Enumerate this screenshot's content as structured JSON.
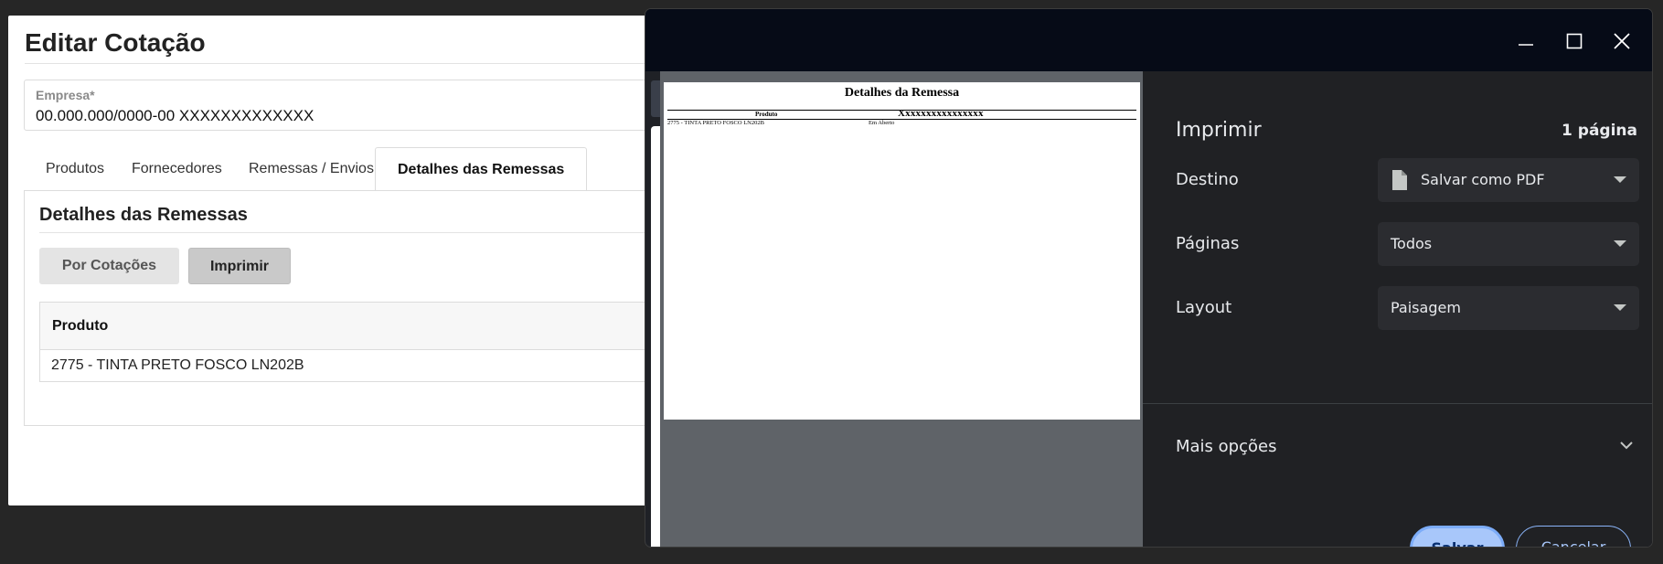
{
  "app": {
    "title": "Editar Cotação",
    "company": {
      "label": "Empresa*",
      "value": "00.000.000/0000-00 XXXXXXXXXXXXX"
    },
    "tabs": [
      {
        "label": "Produtos",
        "active": false
      },
      {
        "label": "Fornecedores",
        "active": false
      },
      {
        "label": "Remessas / Envios",
        "active": false
      },
      {
        "label": "Detalhes das Remessas",
        "active": true
      }
    ],
    "section": {
      "title": "Detalhes das Remessas",
      "buttons": {
        "por_cotacoes": "Por Cotações",
        "imprimir": "Imprimir"
      },
      "table": {
        "header": "Produto",
        "rows": [
          "2775 - TINTA PRETO FOSCO LN202B"
        ]
      }
    }
  },
  "print_dialog": {
    "preview": {
      "title": "Detalhes da Remessa",
      "column": "Produto",
      "masked": "Xxxxxxxxxxxxxxxx",
      "row": "2775 - TINTA PRETO FOSCO LN202B",
      "status": "Em Aberto"
    },
    "settings": {
      "title": "Imprimir",
      "page_count": "1 página",
      "destination": {
        "label": "Destino",
        "value": "Salvar como PDF",
        "icon": "file-icon"
      },
      "pages": {
        "label": "Páginas",
        "value": "Todos"
      },
      "layout": {
        "label": "Layout",
        "value": "Paisagem"
      },
      "more_options": "Mais opções",
      "save": "Salvar",
      "cancel": "Cancelar"
    },
    "window_controls": [
      "minimize-icon",
      "maximize-icon",
      "close-icon"
    ]
  },
  "colors": {
    "dialog_bg": "#202124",
    "titlebar_bg": "#060b17",
    "accent": "#a8c7fa",
    "preview_bg": "#5f6368"
  }
}
